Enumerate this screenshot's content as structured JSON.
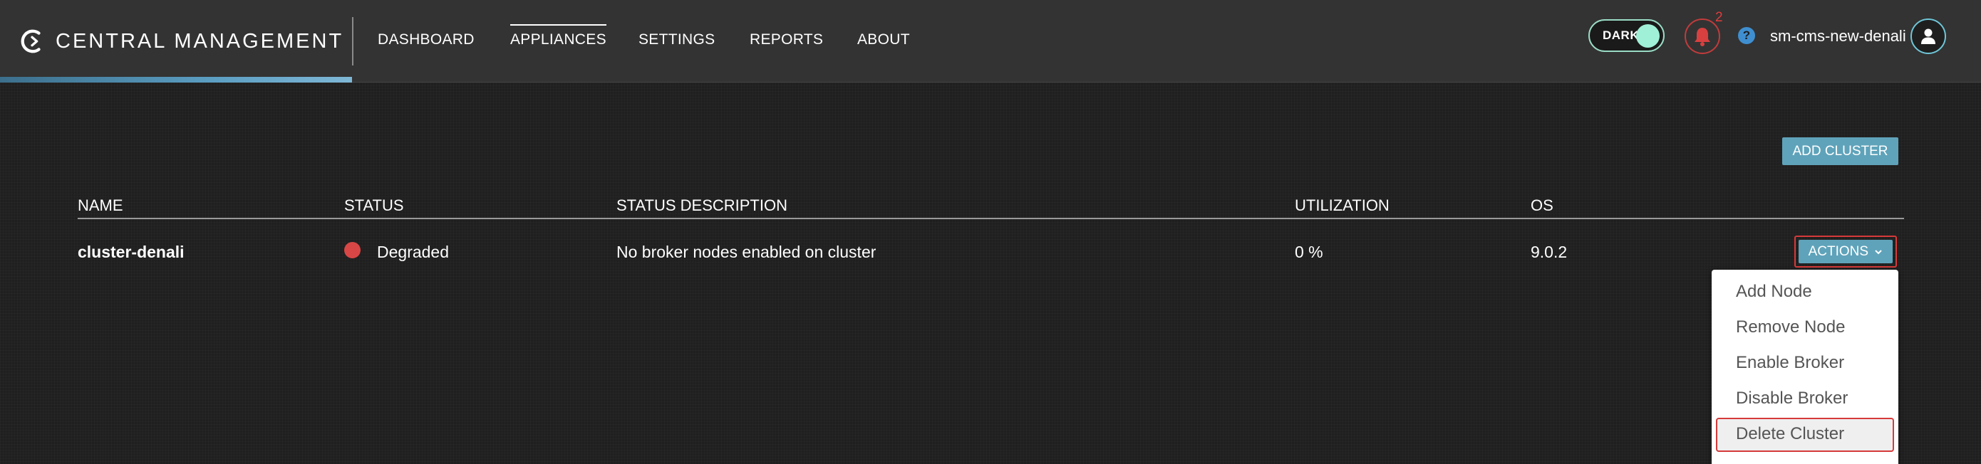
{
  "brand": {
    "name": "CENTRAL MANAGEMENT"
  },
  "nav": {
    "items": [
      {
        "label": "DASHBOARD",
        "active": false
      },
      {
        "label": "APPLIANCES",
        "active": true
      },
      {
        "label": "SETTINGS",
        "active": false
      },
      {
        "label": "REPORTS",
        "active": false
      },
      {
        "label": "ABOUT",
        "active": false
      }
    ]
  },
  "header": {
    "theme_toggle_label": "DARK",
    "notification_count": "2",
    "help_symbol": "?",
    "username": "sm-cms-new-denali"
  },
  "toolbar": {
    "add_cluster_label": "ADD CLUSTER"
  },
  "table": {
    "columns": [
      "NAME",
      "STATUS",
      "STATUS DESCRIPTION",
      "UTILIZATION",
      "OS"
    ],
    "rows": [
      {
        "name": "cluster-denali",
        "status": "Degraded",
        "status_color": "#d94646",
        "status_description": "No broker nodes enabled on cluster",
        "utilization": "0 %",
        "os": "9.0.2",
        "actions_label": "ACTIONS"
      }
    ]
  },
  "actions_menu": {
    "items": [
      "Add Node",
      "Remove Node",
      "Enable Broker",
      "Disable Broker",
      "Delete Cluster"
    ],
    "highlighted": "Delete Cluster"
  },
  "colors": {
    "accent": "#5fa3ba",
    "highlight_outline": "#d63a3a",
    "toggle_knob": "#9ff0d6",
    "notification": "#e03c3c"
  },
  "icons": {
    "logo": "brand-logo-icon",
    "bell": "bell-icon",
    "help": "help-icon",
    "user": "user-icon",
    "chevron": "chevron-down-icon"
  }
}
